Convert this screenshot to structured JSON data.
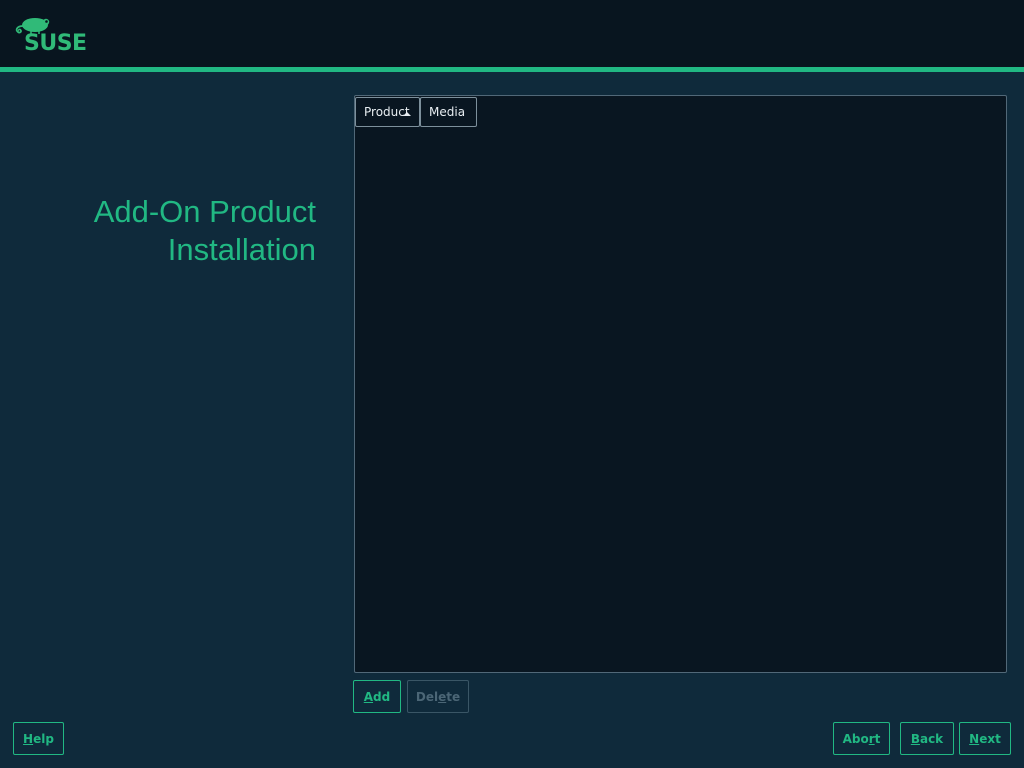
{
  "header": {
    "logo_text": "SUSE",
    "logo_mark": "™",
    "accent_color": "#21b883"
  },
  "page": {
    "title_line1": "Add-On Product",
    "title_line2": "Installation"
  },
  "table": {
    "columns": [
      {
        "label": "Product",
        "sorted": "ascending",
        "sort_icon": "sort-ascending-icon"
      },
      {
        "label": "Media"
      }
    ],
    "rows": []
  },
  "table_actions": {
    "add": {
      "prefix": "",
      "mnemonic": "A",
      "suffix": "dd"
    },
    "delete": {
      "prefix": "Del",
      "mnemonic": "e",
      "suffix": "te",
      "disabled": true
    }
  },
  "footer": {
    "help": {
      "prefix": "",
      "mnemonic": "H",
      "suffix": "elp"
    },
    "abort": {
      "prefix": "Abo",
      "mnemonic": "r",
      "suffix": "t"
    },
    "back": {
      "prefix": "",
      "mnemonic": "B",
      "suffix": "ack"
    },
    "next": {
      "prefix": "",
      "mnemonic": "N",
      "suffix": "ext"
    }
  }
}
